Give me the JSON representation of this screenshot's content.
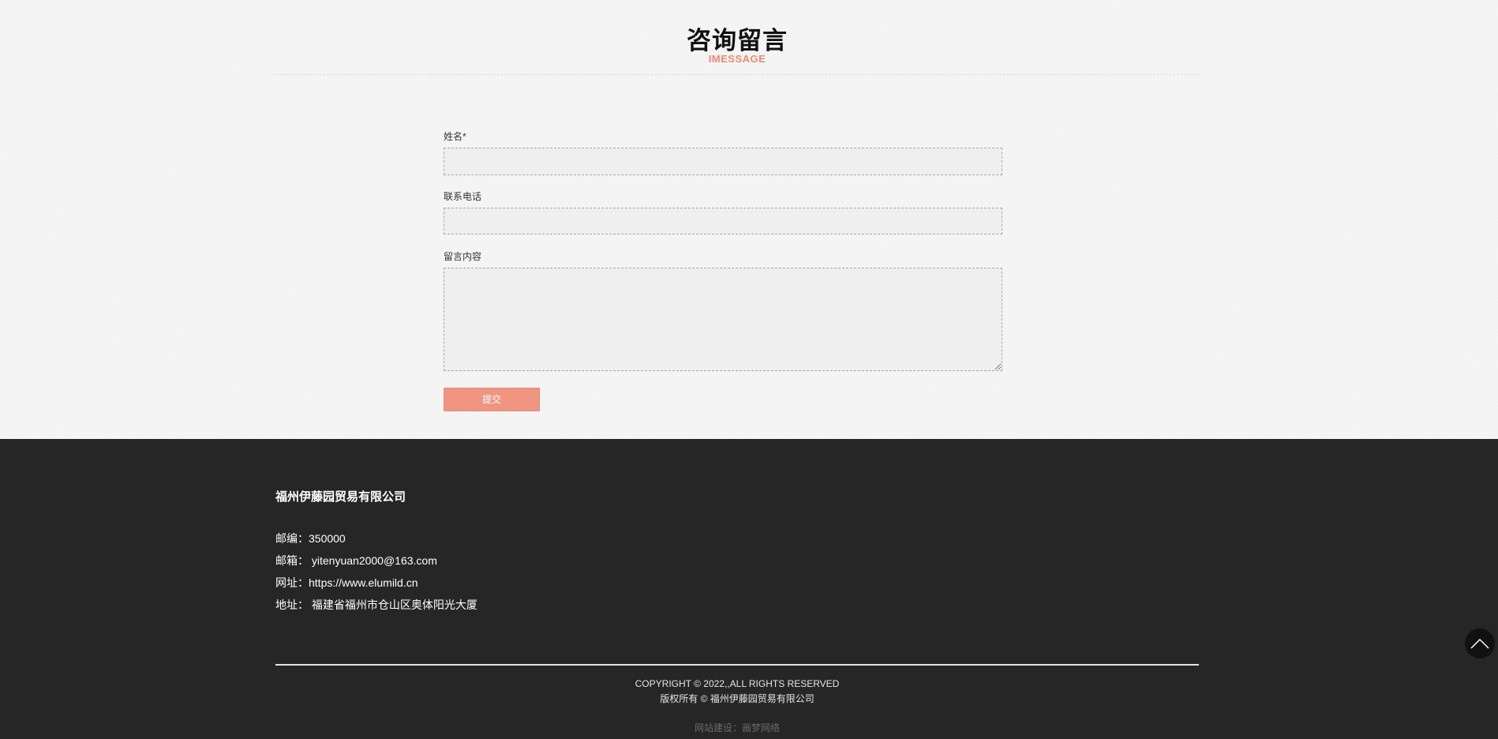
{
  "section": {
    "title": "咨询留言",
    "subtitle": "IMESSAGE"
  },
  "form": {
    "name_label": "姓名*",
    "name_value": "",
    "phone_label": "联系电话",
    "phone_value": "",
    "message_label": "留言内容",
    "message_value": "",
    "submit_label": "提交"
  },
  "footer": {
    "company": "福州伊藤园贸易有限公司",
    "postcode": "邮编：350000",
    "email": "邮箱： yitenyuan2000@163.com",
    "website": "网址：https://www.elumild.cn",
    "address": "地址： 福建省福州市仓山区奥体阳光大厦",
    "copyright": "COPYRIGHT © 2022,,ALL RIGHTS RESERVED",
    "rights": "版权所有 © 福州伊藤园贸易有限公司",
    "credit": "网站建设：画梦网络"
  },
  "icons": {
    "back_to_top": "chevron-up-icon"
  },
  "colors": {
    "accent": "#f09580",
    "subtitle": "#ee8a72",
    "footer_bg": "#262626",
    "page_bg": "#f5f5f5"
  }
}
